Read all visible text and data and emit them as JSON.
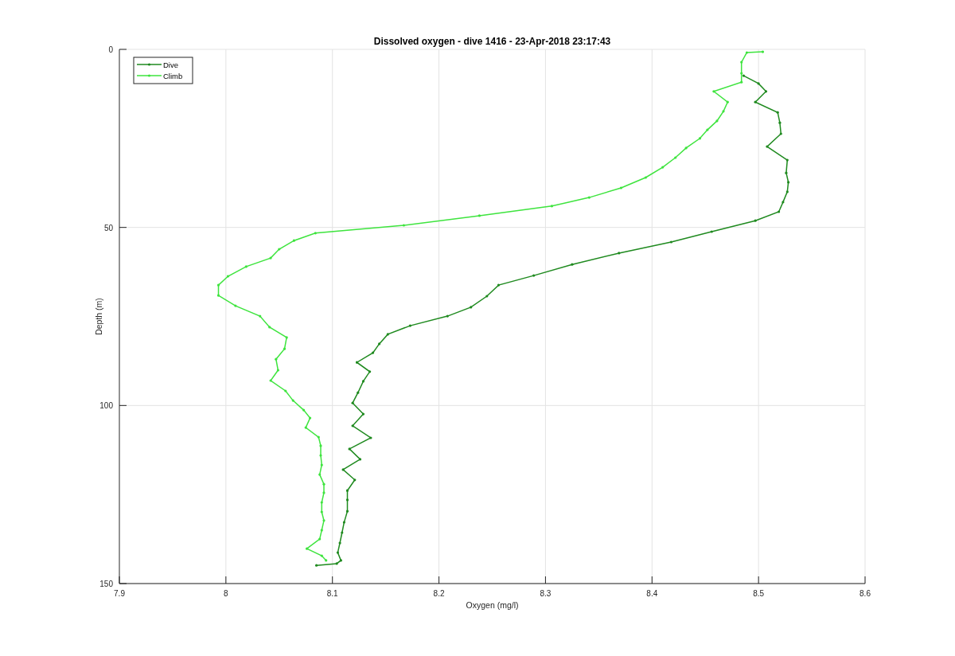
{
  "figure": {
    "chart_data": {
      "type": "line",
      "title": "Dissolved oxygen - dive 1416 - 23-Apr-2018 23:17:43",
      "xlabel": "Oxygen (mg/l)",
      "ylabel": "Depth (m)",
      "orientation": "horizontal",
      "grid": true,
      "legend": true,
      "xlim": [
        7.9,
        8.6
      ],
      "ylim": [
        150,
        0
      ],
      "xticks": [
        {
          "value": 7.9,
          "label": "7.9"
        },
        {
          "value": 8,
          "label": "8"
        },
        {
          "value": 8.1,
          "label": "8.1"
        },
        {
          "value": 8.2,
          "label": "8.2"
        },
        {
          "value": 8.3,
          "label": "8.3"
        },
        {
          "value": 8.4,
          "label": "8.4"
        },
        {
          "value": 8.5,
          "label": "8.5"
        },
        {
          "value": 8.6,
          "label": "8.6"
        }
      ],
      "yticks": [
        0,
        50,
        100,
        150
      ],
      "series": [
        {
          "name": "Dive",
          "color": "#1f8a1f",
          "x": [
            7.4,
            9.6,
            11.8,
            14.8,
            17.7,
            20.6,
            23.7,
            27.3,
            31.1,
            34.7,
            37.3,
            40.0,
            42.9,
            45.6,
            48.1,
            51.2,
            54.1,
            57.2,
            60.4,
            63.5,
            66.2,
            69.3,
            72.4,
            74.9,
            77.6,
            80.0,
            82.7,
            85.2,
            87.9,
            90.5,
            93.2,
            96.4,
            99.3,
            102.4,
            105.7,
            109.1,
            112.2,
            115.1,
            118.0,
            120.9,
            123.9,
            126.5,
            129.7,
            132.8,
            135.7,
            138.6,
            141.3,
            143.5,
            144.4,
            144.9
          ],
          "values": [
            8.486,
            8.5,
            8.507,
            8.497,
            8.518,
            8.52,
            8.521,
            8.508,
            8.527,
            8.526,
            8.528,
            8.527,
            8.523,
            8.519,
            8.497,
            8.456,
            8.418,
            8.369,
            8.325,
            8.289,
            8.256,
            8.245,
            8.23,
            8.208,
            8.173,
            8.152,
            8.144,
            8.138,
            8.123,
            8.135,
            8.129,
            8.124,
            8.119,
            8.129,
            8.119,
            8.136,
            8.116,
            8.126,
            8.11,
            8.121,
            8.114,
            8.114,
            8.114,
            8.111,
            8.109,
            8.107,
            8.105,
            8.108,
            8.104,
            8.085
          ]
        },
        {
          "name": "Climb",
          "color": "#3ee43e",
          "x": [
            0.7,
            0.9,
            3.6,
            6.7,
            9.2,
            11.8,
            14.8,
            17.4,
            20.1,
            22.6,
            25.0,
            27.7,
            30.4,
            33.1,
            36.0,
            38.9,
            41.6,
            44.0,
            46.7,
            49.4,
            51.6,
            53.7,
            56.1,
            58.6,
            61.0,
            63.7,
            66.2,
            69.1,
            72.0,
            74.9,
            78.0,
            80.9,
            84.1,
            87.0,
            90.1,
            93.0,
            95.9,
            98.6,
            101.3,
            103.5,
            106.2,
            108.9,
            111.3,
            114.0,
            116.7,
            119.4,
            122.1,
            124.5,
            127.2,
            129.9,
            132.3,
            135.0,
            137.5,
            140.2,
            142.2,
            143.5
          ],
          "values": [
            8.504,
            8.489,
            8.484,
            8.484,
            8.484,
            8.458,
            8.471,
            8.467,
            8.461,
            8.452,
            8.445,
            8.432,
            8.422,
            8.41,
            8.394,
            8.371,
            8.341,
            8.306,
            8.238,
            8.167,
            8.084,
            8.064,
            8.05,
            8.042,
            8.019,
            8.002,
            7.993,
            7.993,
            8.009,
            8.032,
            8.041,
            8.057,
            8.055,
            8.047,
            8.049,
            8.042,
            8.056,
            8.063,
            8.073,
            8.079,
            8.075,
            8.087,
            8.089,
            8.089,
            8.09,
            8.088,
            8.092,
            8.092,
            8.09,
            8.09,
            8.092,
            8.09,
            8.088,
            8.076,
            8.09,
            8.094
          ]
        }
      ]
    }
  }
}
